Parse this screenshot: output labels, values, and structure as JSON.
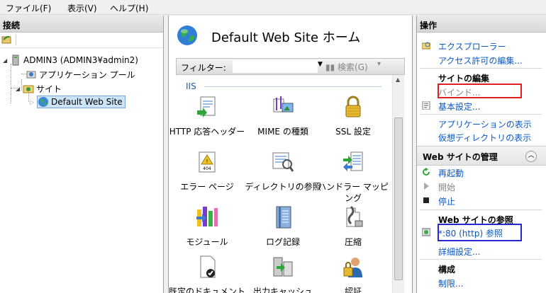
{
  "menu": {
    "file": "ファイル(F)",
    "view": "表示(V)",
    "help": "ヘルプ(H)"
  },
  "connections": {
    "header": "接続",
    "server": "ADMIN3 (ADMIN3¥admin2)",
    "app_pools": "アプリケーション プール",
    "sites": "サイト",
    "default_site": "Default Web Site"
  },
  "center": {
    "title": "Default Web Site ホーム",
    "filter_label": "フィルター:",
    "go_label": "検索(G)",
    "group": "IIS",
    "features": [
      {
        "label": "HTTP 応答ヘッダー",
        "icon": "http-headers-icon"
      },
      {
        "label": "MIME の種類",
        "icon": "mime-types-icon"
      },
      {
        "label": "SSL 設定",
        "icon": "ssl-lock-icon"
      },
      {
        "label": "エラー ページ",
        "icon": "error-pages-icon"
      },
      {
        "label": "ディレクトリの参照",
        "icon": "directory-browsing-icon"
      },
      {
        "label": "ハンドラー マッピング",
        "icon": "handler-mappings-icon"
      },
      {
        "label": "モジュール",
        "icon": "modules-icon"
      },
      {
        "label": "ログ記録",
        "icon": "logging-icon"
      },
      {
        "label": "圧縮",
        "icon": "compression-icon"
      },
      {
        "label": "既定のドキュメント",
        "icon": "default-document-icon"
      },
      {
        "label": "出力キャッシュ",
        "icon": "output-caching-icon"
      },
      {
        "label": "認証",
        "icon": "authentication-icon"
      }
    ]
  },
  "actions": {
    "header": "操作",
    "explore": "エクスプローラー",
    "edit_permissions": "アクセス許可の編集...",
    "edit_site_header": "サイトの編集",
    "bindings": "バインド...",
    "basic_settings": "基本設定...",
    "view_applications": "アプリケーションの表示",
    "view_virtual_dirs": "仮想ディレクトリの表示",
    "manage_header": "Web サイトの管理",
    "restart": "再起動",
    "start": "開始",
    "stop": "停止",
    "browse_header": "Web サイトの参照",
    "browse_80": "*:80 (http) 参照",
    "advanced_settings": "詳細設定...",
    "config_header": "構成",
    "limits": "制限..."
  },
  "colors": {
    "link": "#0a58c4",
    "highlight_red": "#e02020",
    "highlight_blue": "#2828d0"
  }
}
